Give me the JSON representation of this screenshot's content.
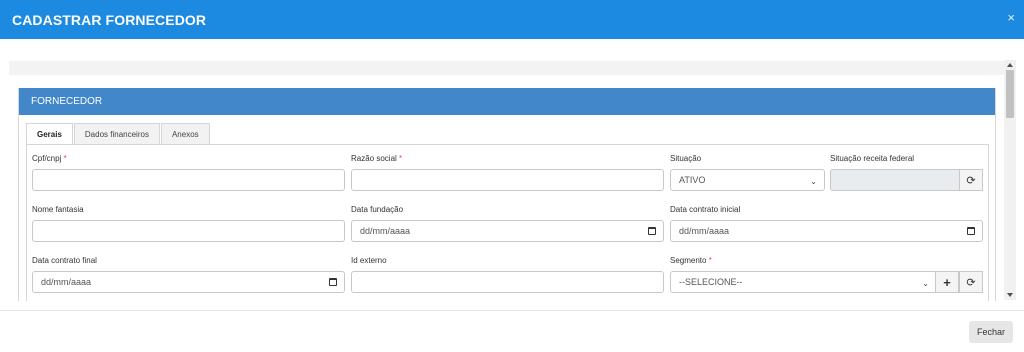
{
  "modal": {
    "title": "CADASTRAR FORNECEDOR",
    "close_glyph": "×"
  },
  "panel": {
    "heading": "FORNECEDOR"
  },
  "tabs": [
    {
      "label": "Gerais",
      "active": true
    },
    {
      "label": "Dados financeiros",
      "active": false
    },
    {
      "label": "Anexos",
      "active": false
    }
  ],
  "form": {
    "cpf_cnpj": {
      "label": "Cpf/cnpj",
      "required": "*",
      "value": ""
    },
    "razao_social": {
      "label": "Razão social",
      "required": "*",
      "value": ""
    },
    "situacao": {
      "label": "Situação",
      "value": "ATIVO"
    },
    "situacao_receita": {
      "label": "Situação receita federal",
      "value": ""
    },
    "nome_fantasia": {
      "label": "Nome fantasia",
      "value": ""
    },
    "data_fundacao": {
      "label": "Data fundação",
      "placeholder": "dd/mm/aaaa"
    },
    "data_contrato_inicial": {
      "label": "Data contrato inicial",
      "placeholder": "dd/mm/aaaa"
    },
    "data_contrato_final": {
      "label": "Data contrato final",
      "placeholder": "dd/mm/aaaa"
    },
    "id_externo": {
      "label": "Id externo",
      "value": ""
    },
    "segmento": {
      "label": "Segmento",
      "required": "*",
      "value": "--SELECIONE--"
    }
  },
  "icons": {
    "refresh": "⟳",
    "plus": "+",
    "chevron": "⌄"
  },
  "footer": {
    "close_label": "Fechar"
  }
}
